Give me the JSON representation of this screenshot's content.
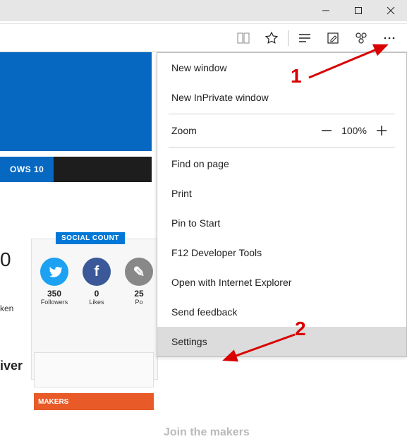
{
  "page": {
    "tab_fragment": "OWS 10",
    "big_zero": "0",
    "ken": "ken",
    "iver": "iver",
    "join": "Join the makers",
    "makers": "MAKERS"
  },
  "social": {
    "badge": "SOCIAL COUNT",
    "items": [
      {
        "glyph": "t",
        "count": "350",
        "label": "Followers"
      },
      {
        "glyph": "f",
        "count": "0",
        "label": "Likes"
      },
      {
        "glyph": "✎",
        "count": "25",
        "label": "Po"
      }
    ]
  },
  "menu": {
    "new_window": "New window",
    "new_inprivate": "New InPrivate window",
    "zoom_label": "Zoom",
    "zoom_value": "100%",
    "find": "Find on page",
    "print": "Print",
    "pin": "Pin to Start",
    "f12": "F12 Developer Tools",
    "open_ie": "Open with Internet Explorer",
    "feedback": "Send feedback",
    "settings": "Settings"
  },
  "annotations": {
    "one": "1",
    "two": "2"
  }
}
